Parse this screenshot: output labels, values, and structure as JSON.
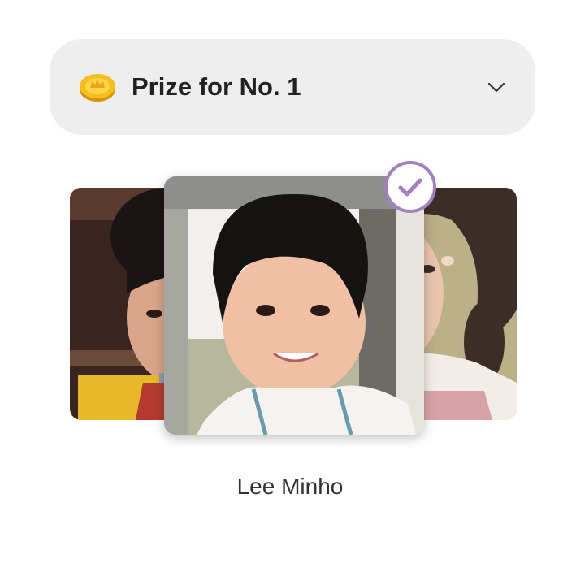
{
  "prize_selector": {
    "icon": "gold-coin-icon",
    "title": "Prize for No. 1",
    "expand_icon": "chevron-down-icon"
  },
  "carousel": {
    "cards": [
      {
        "position": "left",
        "image": "child-photo"
      },
      {
        "position": "center",
        "image": "child-photo",
        "selected": true
      },
      {
        "position": "right",
        "image": "child-photo"
      }
    ],
    "selected_icon": "check-icon",
    "accent_color": "#a37fc4"
  },
  "selected_name": "Lee Minho"
}
